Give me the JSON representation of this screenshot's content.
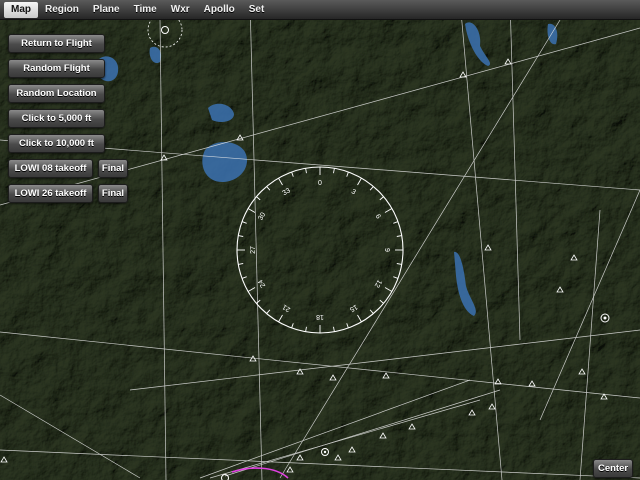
{
  "menu": {
    "items": [
      {
        "label": "Map",
        "active": true
      },
      {
        "label": "Region"
      },
      {
        "label": "Plane"
      },
      {
        "label": "Time"
      },
      {
        "label": "Wxr"
      },
      {
        "label": "Apollo"
      },
      {
        "label": "Set"
      }
    ]
  },
  "actions": {
    "return_to_flight": "Return to Flight",
    "random_flight": "Random Flight",
    "random_location": "Random Location",
    "click_5000": "Click to 5,000 ft",
    "click_10000": "Click to 10,000 ft",
    "lowi08_takeoff": "LOWI 08 takeoff",
    "lowi08_final": "Final",
    "lowi26_takeoff": "LOWI 26 takeoff",
    "lowi26_final": "Final"
  },
  "map": {
    "center_button": "Center",
    "compass_labels": [
      "0",
      "3",
      "6",
      "9",
      "12",
      "15",
      "18",
      "21",
      "24",
      "27",
      "30",
      "33"
    ],
    "colors": {
      "terrain": "#2f3525",
      "lake": "#3a6ea8",
      "route": "#e040e0",
      "lines": "#e8e8e8"
    }
  }
}
